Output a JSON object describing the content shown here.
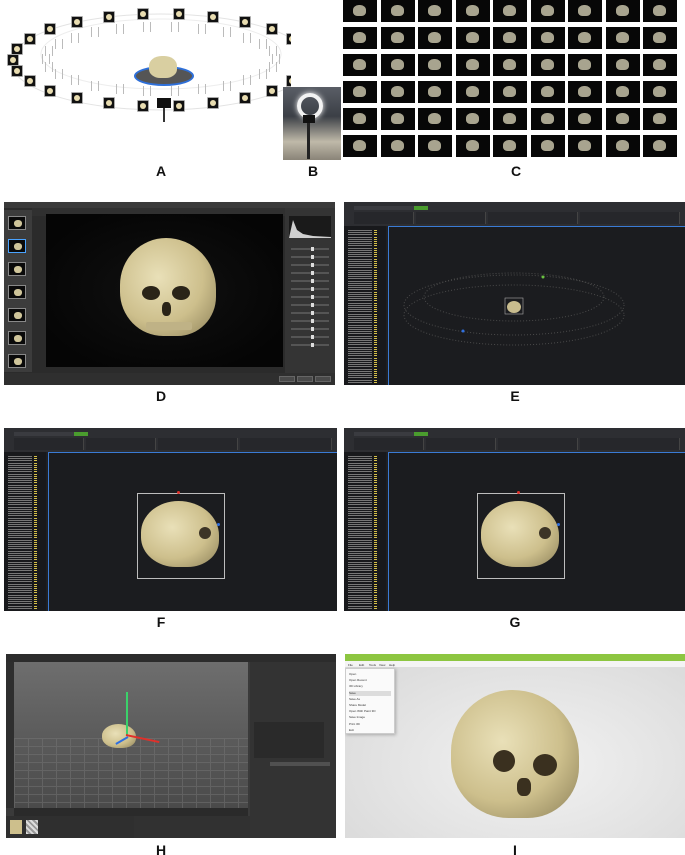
{
  "panel_labels": [
    "A",
    "B",
    "C",
    "D",
    "E",
    "F",
    "G",
    "H",
    "I"
  ],
  "colors": {
    "turntable_ring": "#2e6fd8",
    "skull": "#d9cfa1",
    "selection_border": "#3a7bd5",
    "app_accent": "#8dc641",
    "axis_red": "#e0302a",
    "axis_green": "#3bd16a",
    "axis_blue": "#2f6fe0"
  },
  "icons": [
    "camera-icon",
    "tripod-icon",
    "ring-light-icon",
    "skull-model-icon",
    "turntable-icon",
    "bounding-box-icon",
    "axis-gizmo-icon"
  ],
  "panel_i": {
    "menu": [
      "File",
      "Edit",
      "Tools",
      "View",
      "Help"
    ],
    "dropdown": [
      "Open",
      "Open Recent",
      "3D Library",
      "Save",
      "Save As",
      "Share Model",
      "Open With Paint 3D",
      "Save Image",
      "Print 3D",
      "Exit"
    ],
    "selected_item": "Save"
  }
}
